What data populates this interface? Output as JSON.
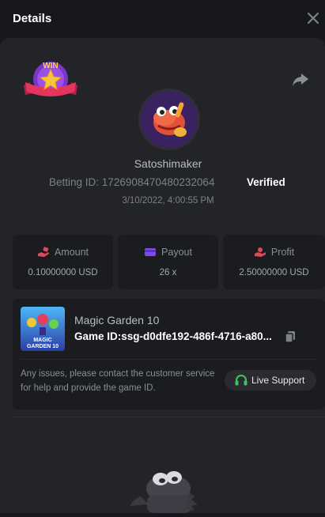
{
  "header": {
    "title": "Details"
  },
  "bet": {
    "username": "Satoshimaker",
    "betting_id_label": "Betting ID:",
    "betting_id": "1726908470480232064",
    "verified": "Verified",
    "datetime": "3/10/2022, 4:00:55 PM",
    "badge": "WIN"
  },
  "stats": [
    {
      "label": "Amount",
      "value": "0.10000000 USD",
      "icon": "coin-hand-icon"
    },
    {
      "label": "Payout",
      "value": "26 x",
      "icon": "card-icon"
    },
    {
      "label": "Profit",
      "value": "2.50000000 USD",
      "icon": "money-hand-icon"
    }
  ],
  "game": {
    "name": "Magic Garden 10",
    "id_label": "Game ID:",
    "id_value": "ssg-d0dfe192-486f-4716-a80...",
    "thumbnail_text_line1": "MAGIC",
    "thumbnail_text_line2": "GARDEN 10"
  },
  "support": {
    "issues_text": "Any issues, please contact the customer service for help and provide the game ID.",
    "button_label": "Live Support"
  },
  "colors": {
    "background": "#17181b",
    "panel": "#232428",
    "card": "#1b1c1f",
    "accent_red": "#e0485e",
    "accent_purple": "#7b4cf0",
    "support_green": "#3fc55a"
  }
}
